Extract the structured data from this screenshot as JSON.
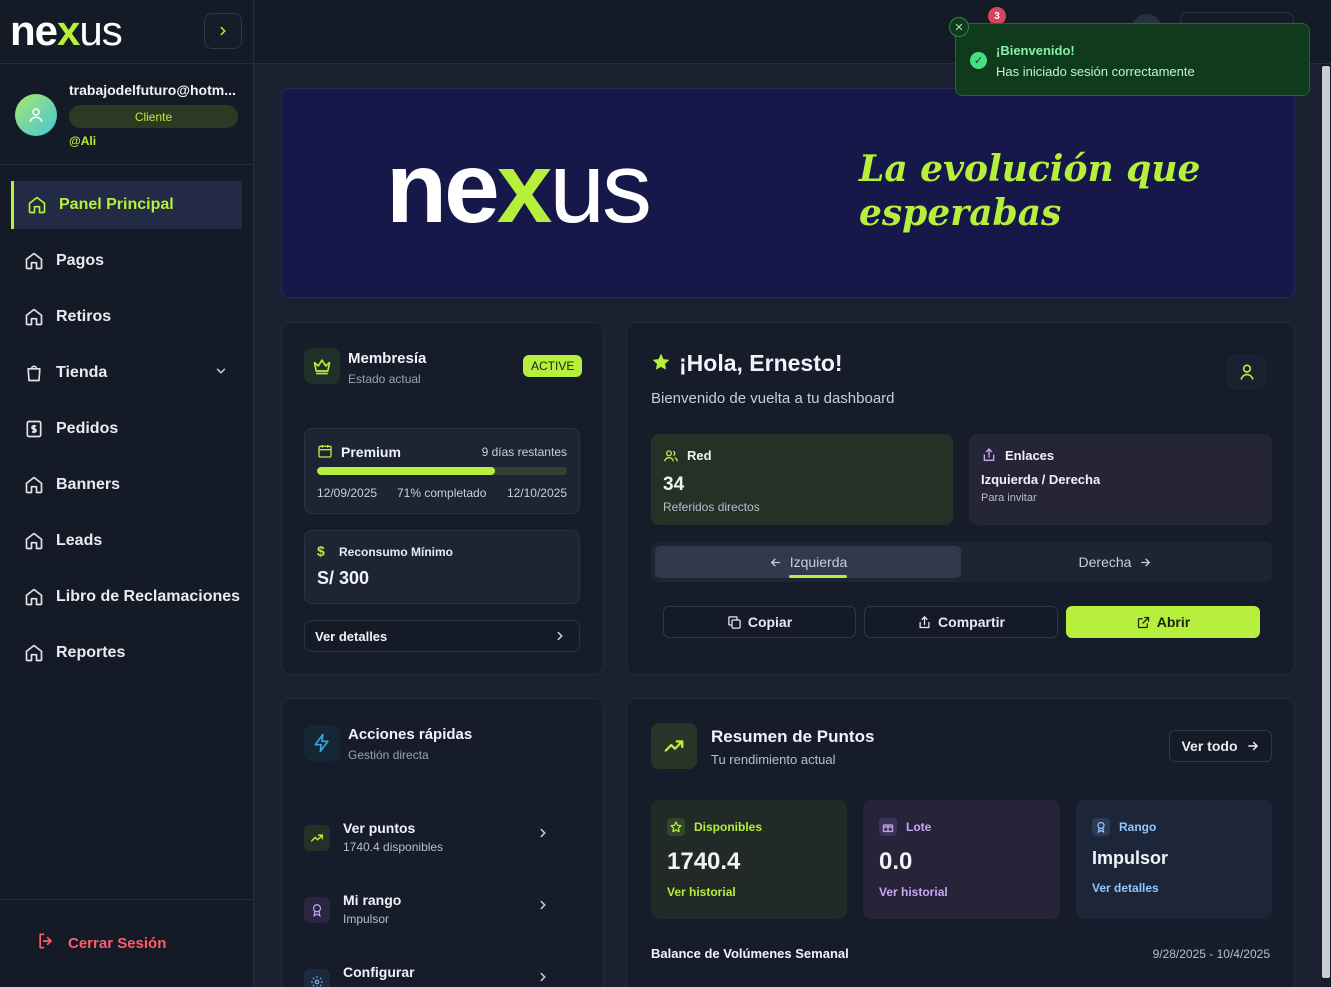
{
  "brand": {
    "logo_ne": "ne",
    "logo_x": "x",
    "logo_us": "us"
  },
  "user": {
    "email": "trabajodelfuturo@hotm...",
    "role": "Cliente",
    "handle": "@Ali"
  },
  "nav": {
    "items": [
      {
        "label": "Panel Principal",
        "icon": "home-icon"
      },
      {
        "label": "Pagos",
        "icon": "home-icon"
      },
      {
        "label": "Retiros",
        "icon": "home-icon"
      },
      {
        "label": "Tienda",
        "icon": "shopping-bag-icon"
      },
      {
        "label": "Pedidos",
        "icon": "dollar-square-icon"
      },
      {
        "label": "Banners",
        "icon": "home-icon"
      },
      {
        "label": "Leads",
        "icon": "home-icon"
      },
      {
        "label": "Libro de Reclamaciones",
        "icon": "home-icon"
      },
      {
        "label": "Reportes",
        "icon": "home-icon"
      }
    ],
    "logout": "Cerrar Sesión"
  },
  "topbar": {
    "notification_count": "3"
  },
  "toast": {
    "title": "¡Bienvenido!",
    "message": "Has iniciado sesión correctamente"
  },
  "banner": {
    "slogan_line1": "La evolución que",
    "slogan_line2": "esperabas"
  },
  "membership": {
    "title": "Membresía",
    "subtitle": "Estado actual",
    "status": "ACTIVE",
    "plan": "Premium",
    "days_left": "9 días restantes",
    "progress": 0.71,
    "start_date": "12/09/2025",
    "completed": "71% completado",
    "end_date": "12/10/2025",
    "min_label": "Reconsumo Mínimo",
    "min_value": "S/ 300",
    "details": "Ver detalles"
  },
  "welcome": {
    "greeting": "¡Hola, Ernesto!",
    "subtitle": "Bienvenido de vuelta a tu dashboard",
    "network_label": "Red",
    "network_count": "34",
    "network_sub": "Referidos directos",
    "links_label": "Enlaces",
    "links_value": "Izquierda / Derecha",
    "links_sub": "Para invitar",
    "tab_left": "Izquierda",
    "tab_right": "Derecha",
    "copy": "Copiar",
    "share": "Compartir",
    "open": "Abrir"
  },
  "quick": {
    "title": "Acciones rápidas",
    "subtitle": "Gestión directa",
    "items": [
      {
        "title": "Ver puntos",
        "sub": "1740.4 disponibles"
      },
      {
        "title": "Mi rango",
        "sub": "Impulsor"
      },
      {
        "title": "Configurar",
        "sub": ""
      }
    ]
  },
  "points": {
    "title": "Resumen de Puntos",
    "subtitle": "Tu rendimiento actual",
    "view_all": "Ver todo",
    "available_label": "Disponibles",
    "available_value": "1740.4",
    "available_link": "Ver historial",
    "lot_label": "Lote",
    "lot_value": "0.0",
    "lot_link": "Ver historial",
    "rank_label": "Rango",
    "rank_value": "Impulsor",
    "rank_link": "Ver detalles",
    "weekly_title": "Balance de Volúmenes Semanal",
    "weekly_range": "9/28/2025 - 10/4/2025"
  },
  "colors": {
    "accent": "#b6f03c",
    "danger": "#ff5c6c",
    "toast_bg": "#0f3a1c"
  }
}
